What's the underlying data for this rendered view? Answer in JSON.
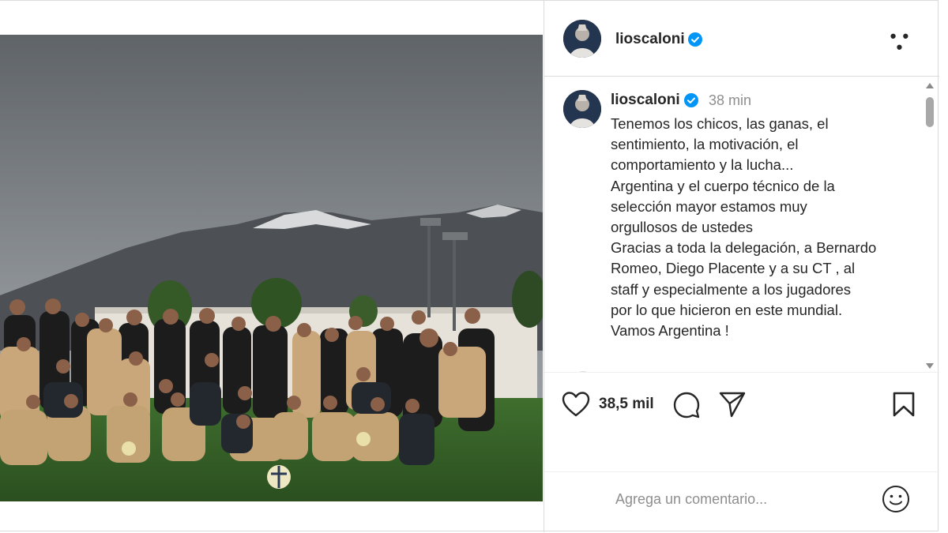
{
  "post": {
    "username": "lioscaloni",
    "verified": true,
    "time": "38 min",
    "caption_lines": [
      "Tenemos los chicos, las ganas, el",
      "sentimiento, la motivación, el",
      "comportamiento y la lucha...",
      "Argentina y el cuerpo técnico de la",
      "selección mayor estamos muy",
      "orgullosos de ustedes",
      "Gracias a toda la delegación, a Bernardo",
      "Romeo, Diego Placente y a su CT , al",
      "staff y especialmente a los jugadores",
      "por lo que hicieron en este mundial.",
      "Vamos Argentina !"
    ],
    "likes": "38,5 mil"
  },
  "header": {
    "more_icon": "more-options-icon"
  },
  "comment_box": {
    "placeholder": "Agrega un comentario..."
  },
  "icons": {
    "like": "heart-icon",
    "comment": "speech-bubble-icon",
    "share": "paper-plane-icon",
    "save": "bookmark-icon",
    "emoji": "smiley-icon",
    "verified": "verified-badge-icon"
  },
  "colors": {
    "verified": "#0095f6",
    "text": "#262626",
    "muted": "#8e8e8e",
    "border": "#dbdbdb"
  }
}
